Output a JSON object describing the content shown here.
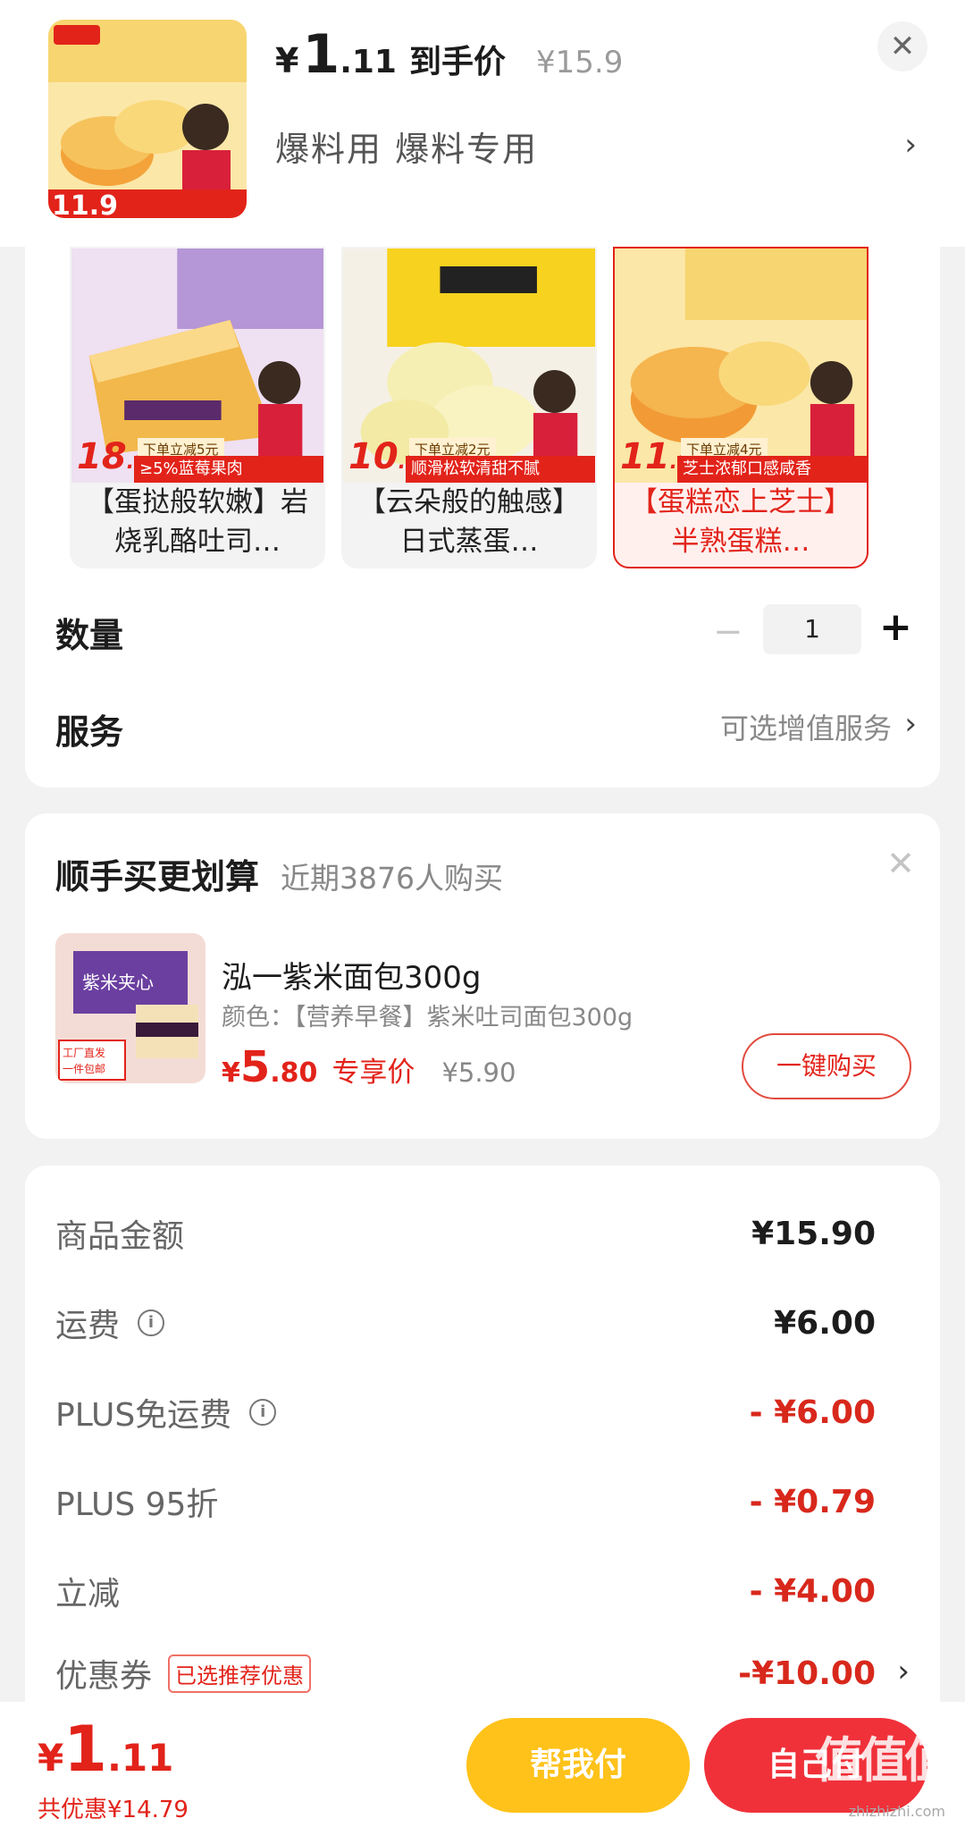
{
  "header": {
    "price_yen": "¥",
    "price_int": "1",
    "price_dec": ".11",
    "price_label": "到手价",
    "original_price": "¥15.9",
    "subtitle": "爆料用  爆料专用",
    "chevron": "›",
    "close": "✕"
  },
  "variants": [
    {
      "title": "【蛋挞般软嫩】岩烧乳酪吐司…",
      "price_int": "18",
      "price_dec": ".9",
      "tag": "下单立减5元",
      "strip": "≥5%蓝莓果肉",
      "selected": false
    },
    {
      "title": "【云朵般的触感】日式蒸蛋…",
      "price_int": "10",
      "price_dec": ".9",
      "tag": "下单立减2元",
      "strip": "顺滑松软清甜不腻",
      "selected": false
    },
    {
      "title": "【蛋糕恋上芝士】半熟蛋糕…",
      "price_int": "11",
      "price_dec": ".9",
      "tag": "下单立减4元",
      "strip": "芝士浓郁口感咸香",
      "selected": true
    }
  ],
  "quantity": {
    "label": "数量",
    "minus": "−",
    "value": "1",
    "plus": "+"
  },
  "service": {
    "label": "服务",
    "value": "可选增值服务",
    "chevron": "›"
  },
  "bundle": {
    "title": "顺手买更划算",
    "subtitle": "近期3876人购买",
    "close": "✕",
    "product_name": "泓一紫米面包300g",
    "spec": "颜色：【营养早餐】紫米吐司面包300g",
    "price_yen": "¥",
    "price_int": "5",
    "price_dec": ".80",
    "price_label": "专享价",
    "original_price": "¥5.90",
    "buy_button": "一键购买",
    "img_text_1": "紫米夹心",
    "img_text_2": "工厂直发",
    "img_text_3": "一件包邮"
  },
  "summary": {
    "rows": [
      {
        "label": "商品金额",
        "value": "¥15.90"
      },
      {
        "label": "运费",
        "value": "¥6.00"
      },
      {
        "label": "PLUS免运费",
        "value": "- ¥6.00"
      },
      {
        "label": "PLUS 95折",
        "value": "- ¥0.79"
      },
      {
        "label": "立减",
        "value": "- ¥4.00"
      },
      {
        "label": "优惠券",
        "value": "-¥10.00",
        "tag": "已选推荐优惠"
      }
    ],
    "chevron": "›"
  },
  "bottom": {
    "total_yen": "¥",
    "total_int": "1",
    "total_dec": ".11",
    "discount": "共优惠¥14.79",
    "help_pay": "帮我付",
    "self_pay": "自己付"
  },
  "watermark": {
    "text": "值值值",
    "url": "zhizhizhi.com"
  },
  "colors": {
    "accent_red": "#e2231a",
    "help_yellow": "#ffc21a",
    "pay_red": "#f0313a"
  }
}
